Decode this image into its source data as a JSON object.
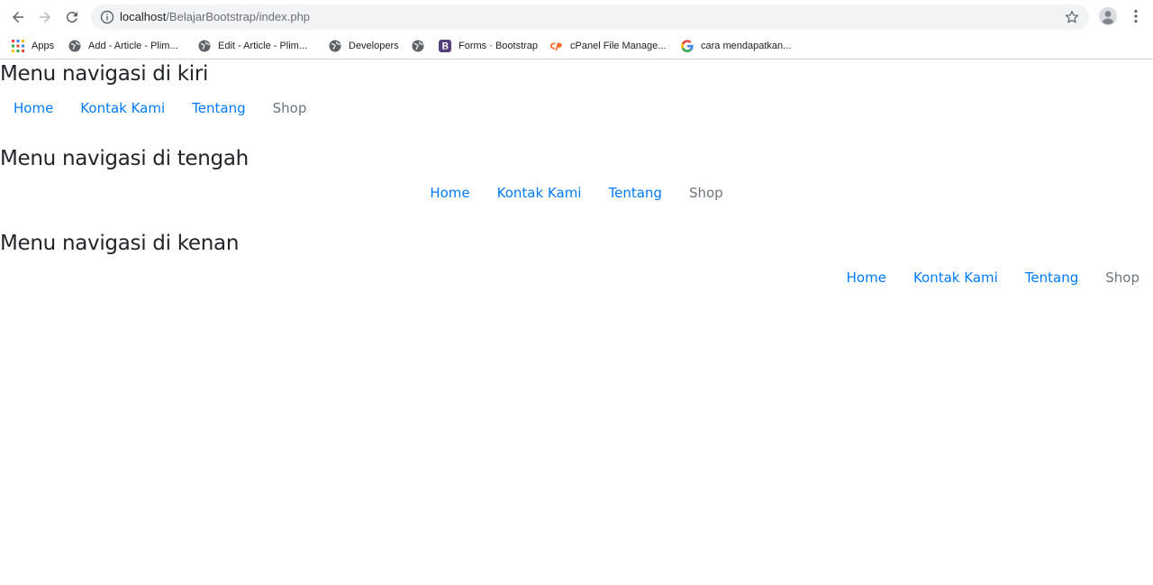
{
  "browser": {
    "url_host": "localhost",
    "url_path": "/BelajarBootstrap/index.php",
    "icons": {
      "back": "arrow-left-icon",
      "forward": "arrow-right-icon",
      "reload": "reload-icon",
      "info": "info-icon",
      "bookmark_star": "star-icon",
      "profile": "profile-icon",
      "menu": "kebab-menu-icon"
    }
  },
  "bookmarks": [
    {
      "label": "Apps",
      "icon": "apps-grid-icon"
    },
    {
      "label": "Add - Article - Plim...",
      "icon": "globe-icon"
    },
    {
      "label": "Edit - Article - Plim...",
      "icon": "globe-icon"
    },
    {
      "label": "Developers",
      "icon": "globe-icon"
    },
    {
      "label": "",
      "icon": "globe-icon"
    },
    {
      "label": "Forms · Bootstrap",
      "icon": "bootstrap-icon"
    },
    {
      "label": "cPanel File Manage...",
      "icon": "cpanel-icon"
    },
    {
      "label": "cara mendapatkan...",
      "icon": "google-icon"
    }
  ],
  "sections": [
    {
      "heading": "Menu navigasi di kiri",
      "links": [
        "Home",
        "Kontak Kami",
        "Tentang",
        "Shop"
      ]
    },
    {
      "heading": "Menu navigasi di tengah",
      "links": [
        "Home",
        "Kontak Kami",
        "Tentang",
        "Shop"
      ]
    },
    {
      "heading": "Menu navigasi di kenan",
      "links": [
        "Home",
        "Kontak Kami",
        "Tentang",
        "Shop"
      ]
    }
  ],
  "colors": {
    "link": "#007bff",
    "disabled_link": "#6c757d",
    "heading": "#212529"
  }
}
